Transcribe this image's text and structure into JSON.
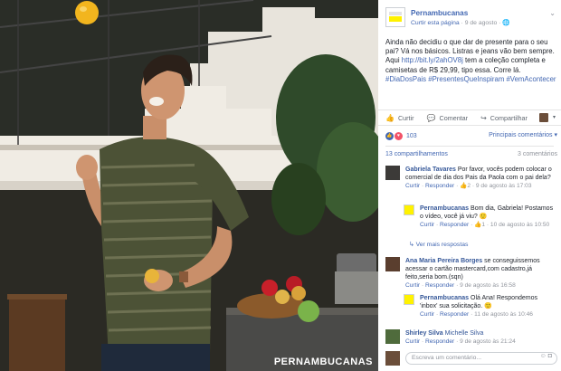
{
  "photo": {
    "watermark": "PERNAMBUCANAS"
  },
  "post": {
    "page_name": "Pernambucanas",
    "meta_link": "Curtir esta página",
    "meta_sep": " · ",
    "date": "9 de agosto ·",
    "globe": "🌐",
    "text_1": "Ainda não decidiu o que dar de presente para o seu pai? Vá nos básicos. Listras e jeans vão bem sempre. Aqui ",
    "link": "http://bit.ly/2ahOV8j",
    "text_2": " tem a coleção completa e camisetas de R$ 29,99, tipo essa. Corre lá. ",
    "hashtags": "#DiaDosPais #PresentesQueInspiram #VemAcontecer"
  },
  "actions": {
    "like": "Curtir",
    "comment": "Comentar",
    "share": "Compartilhar"
  },
  "reactions": {
    "count": "103",
    "sort": "Principais comentários ▾"
  },
  "counts": {
    "shares": "13 compartilhamentos",
    "comments": "3 comentários"
  },
  "comments": [
    {
      "name": "Gabriela Tavares",
      "text": " Por favor, vocês podem colocar o comercial de dia dos Pais da Paola com o pai dela?",
      "like": "Curtir",
      "reply": "Responder",
      "likes": "👍2",
      "time": "9 de agosto às 17:03"
    },
    {
      "name": "Pernambucanas",
      "text": " Bom dia, Gabriela! Postamos o vídeo, você já viu? 🙂",
      "like": "Curtir",
      "reply": "Responder",
      "likes": "👍1",
      "time": "10 de agosto às 10:50"
    },
    {
      "name": "Ana Maria Pereira Borges",
      "text": " se conseguissemos acessar o cartão mastercard,com cadastro,já feito,seria bom.(sqn)",
      "like": "Curtir",
      "reply": "Responder",
      "time": "9 de agosto às 16:58"
    },
    {
      "name": "Pernambucanas",
      "text": " Olá Ana! Respondemos 'inbox' sua solicitação. 🙂",
      "like": "Curtir",
      "reply": "Responder",
      "time": "11 de agosto às 10:46"
    },
    {
      "name": "Shirley Silva",
      "text": " Michelle Silva",
      "like": "Curtir",
      "reply": "Responder",
      "time": "9 de agosto às 21:24"
    }
  ],
  "more_replies": "Ver mais respostas",
  "compose": {
    "placeholder": "Escreva um comentário..."
  },
  "colors": {
    "fb_blue": "#4267b2",
    "brand_yellow": "#fff200"
  }
}
